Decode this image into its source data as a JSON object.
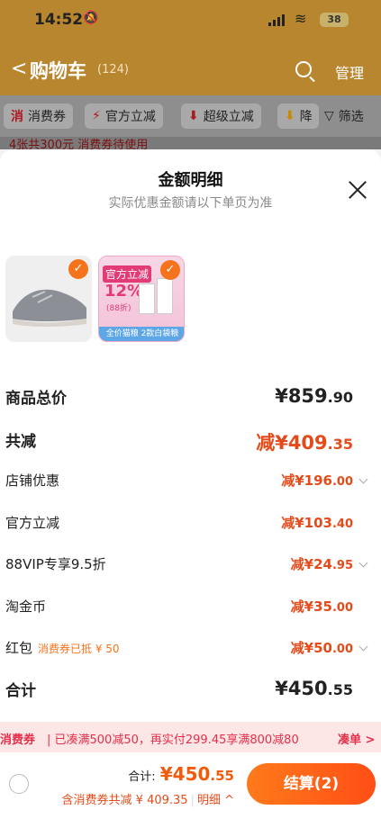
{
  "status": {
    "time": "14:52",
    "battery": "38"
  },
  "header": {
    "back": "<",
    "title": "购物车",
    "count": "(124)",
    "manage": "管理"
  },
  "filters": [
    {
      "icon": "消",
      "label": "消费券"
    },
    {
      "icon": "⚡",
      "label": "官方立减"
    },
    {
      "icon": "⬇",
      "label": "超级立减"
    },
    {
      "icon": "⬇",
      "label": "降"
    },
    {
      "icon": "▽",
      "label": "筛选"
    }
  ],
  "notice": "4张共300元 消费券待使用",
  "sheet": {
    "title": "金额明细",
    "subtitle": "实际优惠金额请以下单页为准"
  },
  "promo_card": {
    "badge": "官方立减",
    "pct": "12%",
    "off": "(88折)",
    "footer": "全价猫粮 2款白袋粮"
  },
  "rows": {
    "subtotal": {
      "label": "商品总价",
      "int": "¥859",
      "dec": ".90"
    },
    "discount": {
      "label": "共减",
      "int": "减¥409",
      "dec": ".35"
    },
    "store": {
      "label": "店铺优惠",
      "int": "减¥196",
      "dec": ".00"
    },
    "official": {
      "label": "官方立减",
      "int": "减¥103",
      "dec": ".40"
    },
    "vip": {
      "label": "88VIP专享9.5折",
      "int": "减¥24",
      "dec": ".95"
    },
    "coins": {
      "label": "淘金币",
      "int": "减¥35",
      "dec": ".00"
    },
    "redpack": {
      "label": "红包",
      "note": "消费券已抵 ¥ 50",
      "int": "减¥50",
      "dec": ".00"
    },
    "total": {
      "label": "合计",
      "int": "¥450",
      "dec": ".55"
    }
  },
  "coupon_bar": {
    "tag": "消费券",
    "message": "| 已凑满500减50，再实付299.45享满800减80",
    "action": "凑单 >"
  },
  "bottom": {
    "total_label": "合计:",
    "total_int": "¥450",
    "total_dec": ".55",
    "sub_info": "含消费券共减 ¥ 409.35",
    "detail": "明细 ^",
    "checkout": "结算(2)"
  }
}
